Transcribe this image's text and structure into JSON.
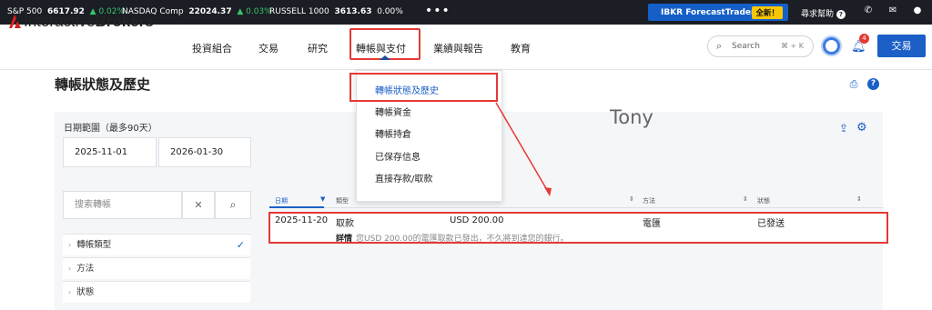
{
  "ticker": {
    "sp_label": "S&P 500",
    "sp_value": "6617.92",
    "sp_change": "▲ 0.02%",
    "nasdaq_label": "NASDAQ Comp",
    "nasdaq_value": "22024.37",
    "nasdaq_change": "▲ 0.03%",
    "russell_label": "RUSSELL 1000",
    "russell_value": "3613.63",
    "russell_change": "0.00%",
    "more": "•••",
    "promo_label": "IBKR ForecastTrader",
    "promo_badge": "全新！",
    "help_label": "尋求幫助"
  },
  "header": {
    "logo_regular": "Interactive",
    "logo_bold": "Brokers",
    "nav": [
      "投資組合",
      "交易",
      "研究",
      "轉帳與支付",
      "業績與報告",
      "教育"
    ],
    "search_placeholder": "Search",
    "search_shortcut": "⌘ + K",
    "notification_count": "4",
    "trade_button": "交易"
  },
  "dropdown": {
    "items": [
      "轉帳狀態及歷史",
      "轉帳資金",
      "轉帳持倉",
      "已保存信息",
      "直接存款/取款"
    ]
  },
  "page": {
    "title": "轉帳狀態及歷史",
    "date_range_label": "日期範圍（最多90天）",
    "date_from": "2025-11-01",
    "date_to": "2026-01-30",
    "annotation": "Tony",
    "search_placeholder": "搜索轉帳",
    "filters": [
      "轉帳類型",
      "方法",
      "狀態"
    ]
  },
  "table": {
    "headers": [
      "日期",
      "類型",
      "方法",
      "狀態"
    ],
    "rows": [
      {
        "date": "2025-11-20",
        "type": "取款",
        "amount": "USD 200.00",
        "method": "電匯",
        "status": "已發送",
        "detail_label": "詳情",
        "detail_text": "您USD 200.00的電匯取款已發出，不久將到達您的銀行。"
      }
    ]
  },
  "colors": {
    "accent": "#1b5fc7",
    "highlight": "#e53935",
    "ticker_bg": "#1b1e24",
    "positive": "#39c46b"
  }
}
